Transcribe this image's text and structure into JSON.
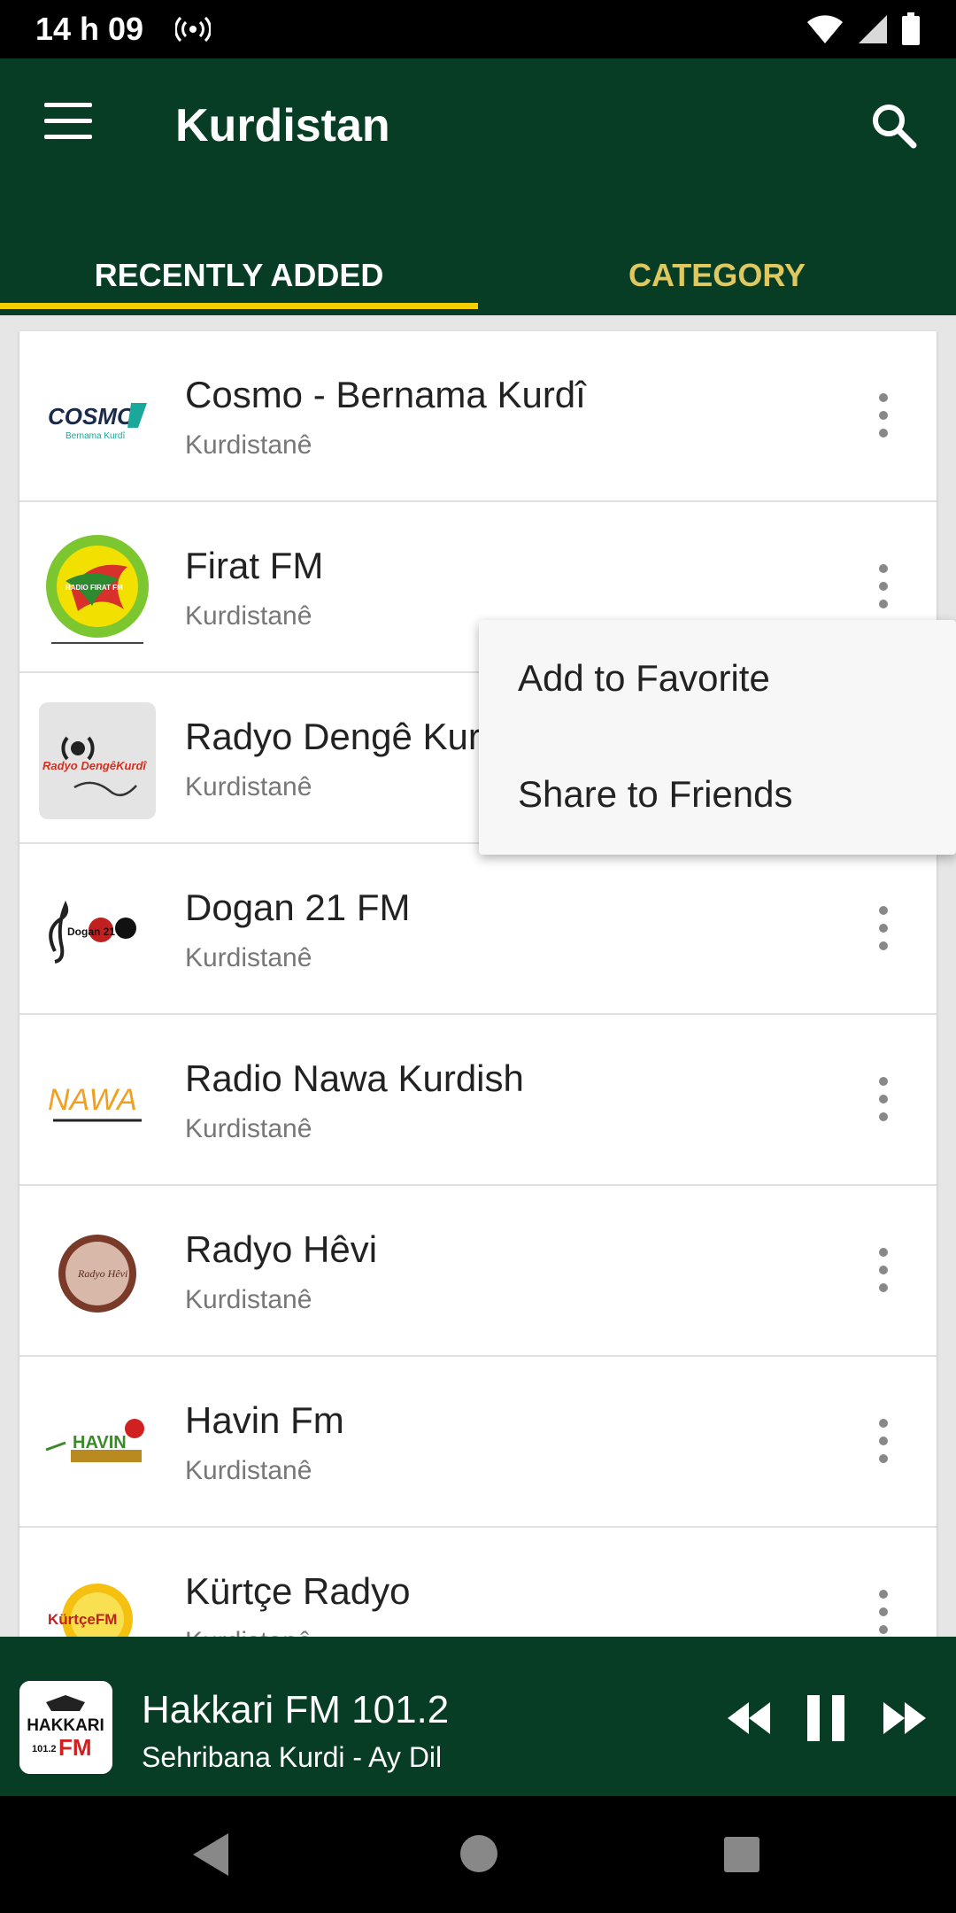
{
  "status": {
    "time": "14 h 09"
  },
  "header": {
    "title": "Kurdistan",
    "menu_icon": "hamburger-menu-icon",
    "search_icon": "search-icon",
    "accent": "#f5d000",
    "bar_color": "#063d24"
  },
  "tabs": [
    {
      "label": "RECENTLY ADDED",
      "active": true
    },
    {
      "label": "CATEGORY",
      "active": false
    }
  ],
  "stations": [
    {
      "name": "Cosmo - Bernama Kurdî",
      "region": "Kurdistanê",
      "logo_text": "COSMO",
      "logo_sub": "Bernama Kurdî"
    },
    {
      "name": "Firat FM",
      "region": "Kurdistanê",
      "logo_text": "RADIO FIRAT FM"
    },
    {
      "name": "Radyo Dengê Kur",
      "region": "Kurdistanê",
      "logo_text": "Radyo DengêKurdî"
    },
    {
      "name": "Dogan 21 FM",
      "region": "Kurdistanê",
      "logo_text": "Dogan 21 FM"
    },
    {
      "name": "Radio Nawa Kurdish",
      "region": "Kurdistanê",
      "logo_text": "NAWA"
    },
    {
      "name": "Radyo Hêvi",
      "region": "Kurdistanê",
      "logo_text": "Radyo Hêvi"
    },
    {
      "name": "Havin Fm",
      "region": "Kurdistanê",
      "logo_text": "HAVIN"
    },
    {
      "name": "Kürtçe Radyo",
      "region": "Kurdistanê",
      "logo_text": "KürtçeFM"
    }
  ],
  "popup_menu": {
    "add_favorite": "Add to Favorite",
    "share": "Share to Friends"
  },
  "player": {
    "title": "Hakkari FM 101.2",
    "subtitle": "Sehribana Kurdi - Ay Dil",
    "logo_text": "HAKKARI",
    "logo_freq": "101.2",
    "logo_fm": "FM",
    "state": "playing"
  }
}
